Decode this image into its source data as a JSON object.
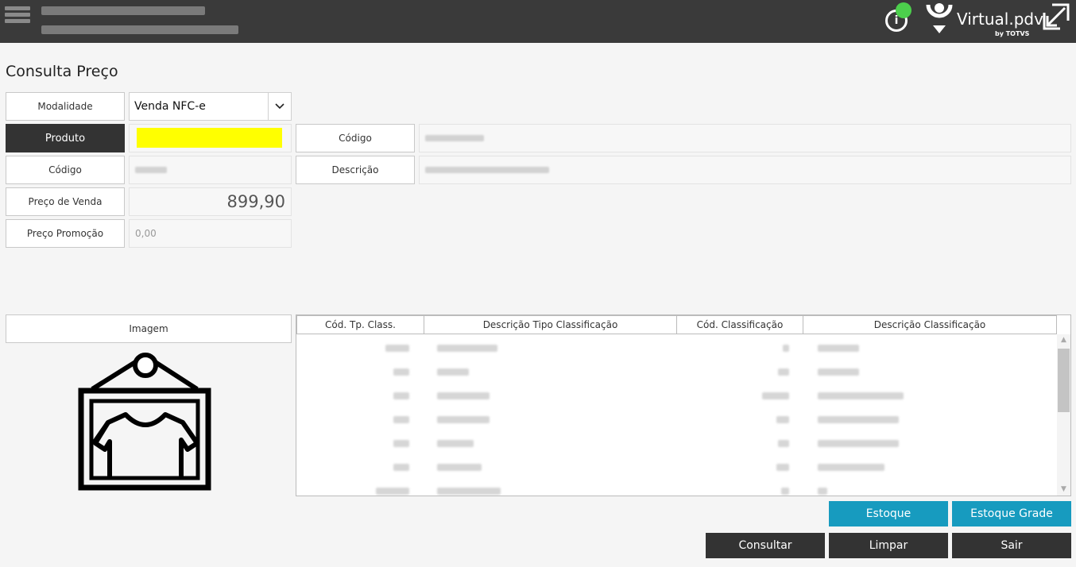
{
  "header": {
    "app_name": "Virtual.pdv",
    "app_sub": "by TOTVS",
    "info_symbol": "i"
  },
  "page": {
    "title": "Consulta Preço"
  },
  "form": {
    "modalidade_label": "Modalidade",
    "modalidade_value": "Venda NFC-e",
    "produto_label": "Produto",
    "codigo_label": "Código",
    "codigo2_label": "Código",
    "descricao_label": "Descrição",
    "preco_venda_label": "Preço de Venda",
    "preco_venda_value": "899,90",
    "preco_promocao_label": "Preço Promoção",
    "preco_promocao_value": "0,00",
    "highlight_color": "#ffff00"
  },
  "image_panel": {
    "label": "Imagem",
    "icon": "framed-shirt-icon"
  },
  "grid": {
    "columns": [
      "Cód. Tp. Class.",
      "Descrição Tipo Classificação",
      "Cód. Classificação",
      "Descrição Classificação"
    ]
  },
  "buttons": {
    "estoque": "Estoque",
    "estoque_grade": "Estoque Grade",
    "consultar": "Consultar",
    "limpar": "Limpar",
    "sair": "Sair"
  },
  "colors": {
    "topbar": "#3a3a3a",
    "accent_blue": "#179bbf",
    "dark_button": "#333333",
    "status_online": "#4ccf4c"
  }
}
